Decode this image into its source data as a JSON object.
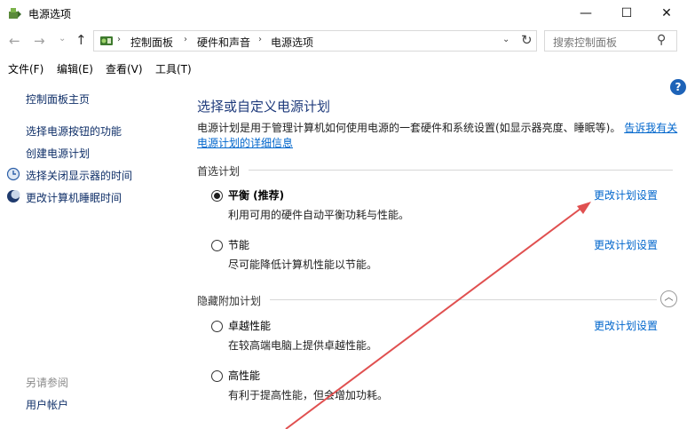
{
  "window": {
    "title": "电源选项",
    "minimize": "—",
    "maximize": "☐",
    "close": "✕"
  },
  "nav": {
    "back": "←",
    "forward": "→",
    "recent": "⌄",
    "up": "↑",
    "breadcrumb": [
      "控制面板",
      "硬件和声音",
      "电源选项"
    ],
    "separator": "›",
    "dropdown": "⌄",
    "refresh": "↻",
    "search_placeholder": "搜索控制面板",
    "search_glyph": "⚲"
  },
  "menu": [
    "文件(F)",
    "编辑(E)",
    "查看(V)",
    "工具(T)"
  ],
  "help": "?",
  "sidebar": {
    "home": "控制面板主页",
    "links": [
      "选择电源按钮的功能",
      "创建电源计划",
      "选择关闭显示器的时间",
      "更改计算机睡眠时间"
    ],
    "see_also_label": "另请参阅",
    "see_also_links": [
      "用户帐户"
    ]
  },
  "main": {
    "title": "选择或自定义电源计划",
    "description": "电源计划是用于管理计算机如何使用电源的一套硬件和系统设置(如显示器亮度、睡眠等)。",
    "description_link": "告诉我有关电源计划的详细信息",
    "preferred_label": "首选计划",
    "hidden_label": "隐藏附加计划",
    "collapse_glyph": "︿",
    "plans": [
      {
        "name": "平衡 (推荐)",
        "desc": "利用可用的硬件自动平衡功耗与性能。",
        "selected": true,
        "link": "更改计划设置"
      },
      {
        "name": "节能",
        "desc": "尽可能降低计算机性能以节能。",
        "selected": false,
        "link": "更改计划设置"
      },
      {
        "name": "卓越性能",
        "desc": "在较高端电脑上提供卓越性能。",
        "selected": false,
        "link": "更改计划设置"
      },
      {
        "name": "高性能",
        "desc": "有利于提高性能，但会增加功耗。",
        "selected": false,
        "link": ""
      }
    ]
  },
  "colors": {
    "link": "#0066cc",
    "title": "#1e3a7b",
    "annotation_arrow": "#e05050"
  }
}
